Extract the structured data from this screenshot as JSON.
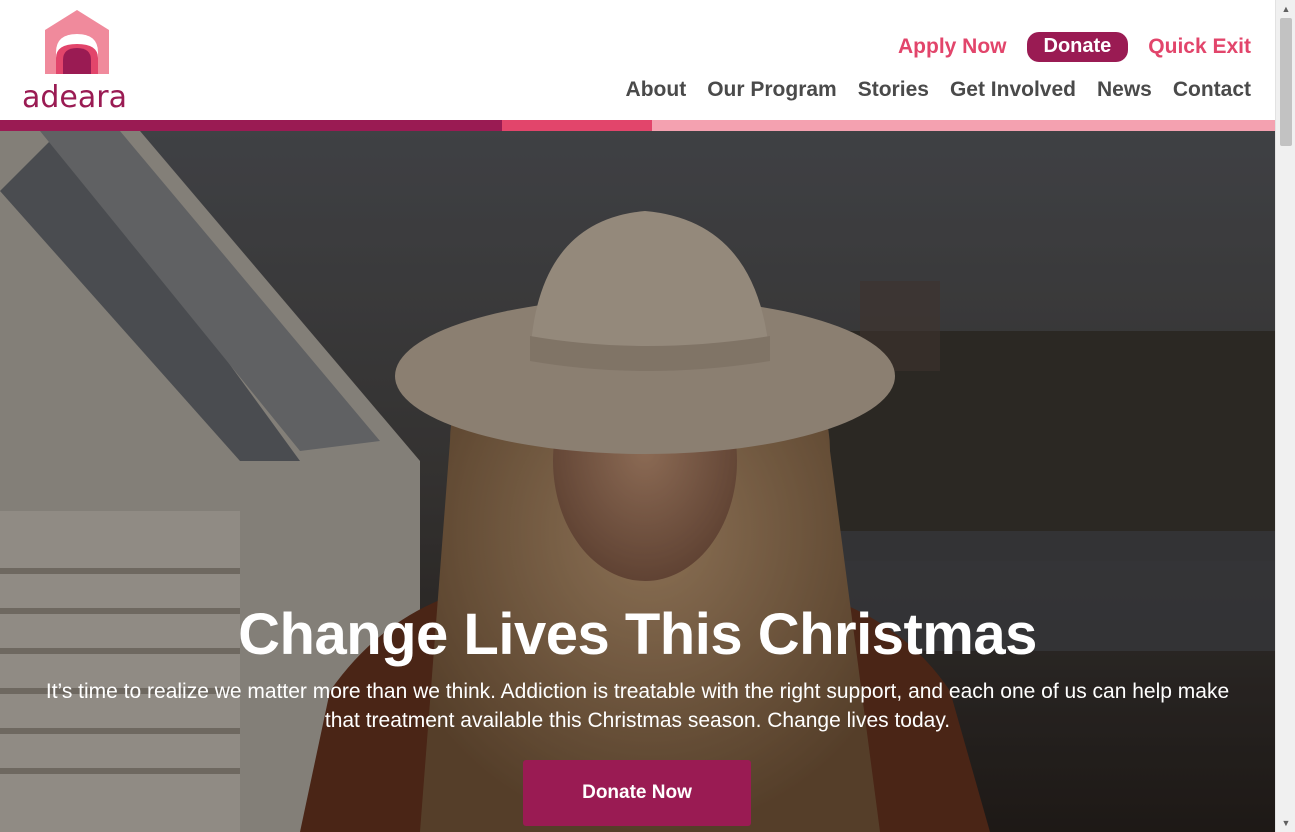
{
  "brand": {
    "logo_text": "adeara",
    "logo_icon": "house-arch-icon",
    "primary_color": "#9a1b53",
    "accent_color": "#e2456b",
    "light_color": "#f4a1b0"
  },
  "utility_nav": {
    "apply_label": "Apply Now",
    "donate_label": "Donate",
    "quick_exit_label": "Quick Exit"
  },
  "main_nav": {
    "items": [
      {
        "label": "About"
      },
      {
        "label": "Our Program"
      },
      {
        "label": "Stories"
      },
      {
        "label": "Get Involved"
      },
      {
        "label": "News"
      },
      {
        "label": "Contact"
      }
    ]
  },
  "hero": {
    "title": "Change Lives This Christmas",
    "text": "It’s time to realize we matter more than we think. Addiction is treatable with the right support, and each one of us can help make that treatment available this Christmas season. Change lives today.",
    "cta_label": "Donate Now"
  },
  "scrollbar": {
    "up_icon": "triangle-up-icon",
    "down_icon": "triangle-down-icon"
  }
}
